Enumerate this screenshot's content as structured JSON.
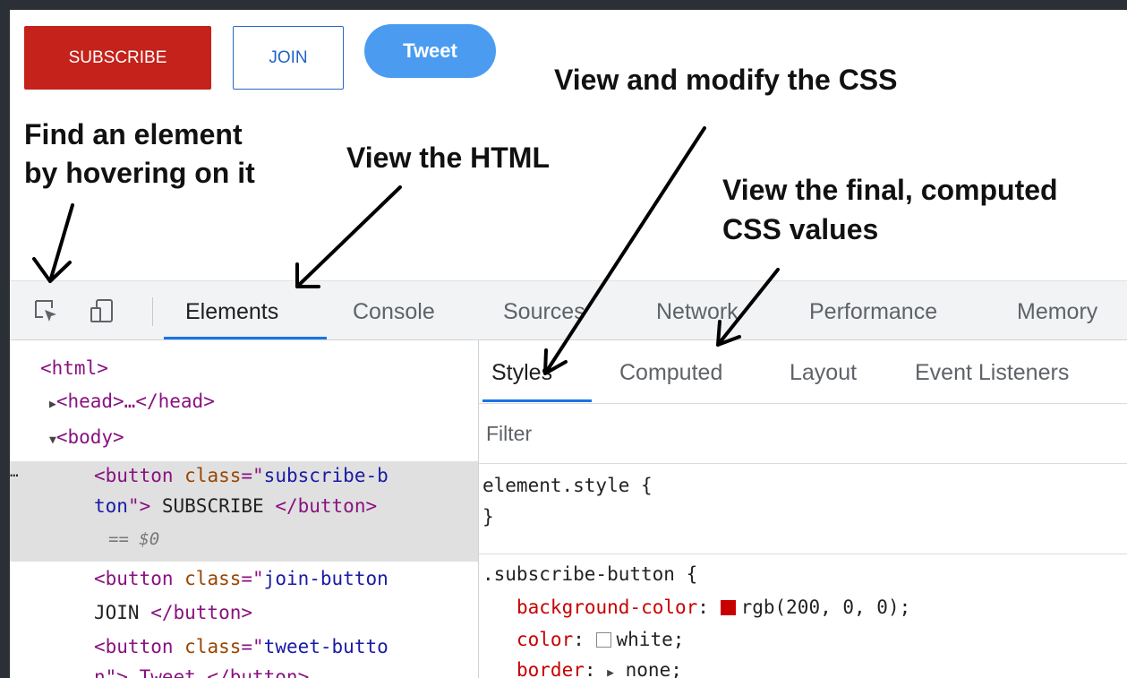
{
  "demo_buttons": {
    "subscribe": "SUBSCRIBE",
    "join": "JOIN",
    "tweet": "Tweet"
  },
  "annotations": {
    "find_line1": "Find an element",
    "find_line2": "by hovering on it",
    "view_html": "View the HTML",
    "modify_css": "View and modify the CSS",
    "computed_line1": "View the final, computed",
    "computed_line2": "CSS values"
  },
  "devtools": {
    "toolbar_icons": [
      "inspect-element-icon",
      "device-toggle-icon"
    ],
    "tabs": [
      "Elements",
      "Console",
      "Sources",
      "Network",
      "Performance",
      "Memory"
    ],
    "active_tab": "Elements",
    "dom_lines": {
      "html": "<html>",
      "head": "<head>…</head>",
      "body": "<body>",
      "ellipsis": "…",
      "b1_open": "<button ",
      "b1_attr": "class",
      "b1_eq": "=\"",
      "b1_val1": "subscribe-b",
      "b1_val2": "ton",
      "b1_close": "\">",
      "b1_text": " SUBSCRIBE ",
      "b1_end": "</button>",
      "b1_ref": "== $0",
      "b2_open": "<button ",
      "b2_attr": "class",
      "b2_eq": "=\"",
      "b2_val": "join-button",
      "b2_text": "JOIN ",
      "b2_end": "</button>",
      "b3_open": "<button ",
      "b3_attr": "class",
      "b3_eq": "=\"",
      "b3_val": "tweet-butto",
      "b3_line2": "n\"> Tweet </button>"
    },
    "styles_tabs": [
      "Styles",
      "Computed",
      "Layout",
      "Event Listeners"
    ],
    "active_styles_tab": "Styles",
    "filter_placeholder": "Filter",
    "css": {
      "element_style_open": "element.style {",
      "element_style_close": "}",
      "rule_selector": ".subscribe-button {",
      "prop1": "background-color",
      "val1": "rgb(200, 0, 0);",
      "prop2": "color",
      "val2": "white;",
      "prop3": "border",
      "val3": "none;"
    },
    "swatch_colors": {
      "background": "#c80000",
      "color": "#ffffff"
    }
  },
  "colors": {
    "subscribe_bg": "#c4221a",
    "join_text": "#1f64c7",
    "tweet_bg": "#4b9cf1",
    "accent": "#1a73e8"
  }
}
